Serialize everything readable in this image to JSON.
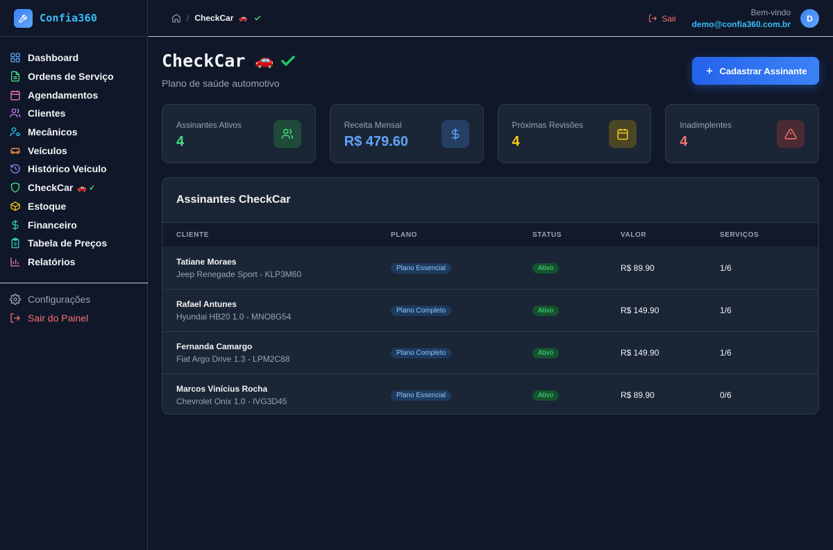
{
  "brand": {
    "name": "Confia360"
  },
  "sidebar": {
    "items": [
      {
        "label": "Dashboard",
        "icon": "grid-icon",
        "color": "#60a5fa"
      },
      {
        "label": "Ordens de Serviço",
        "icon": "file-icon",
        "color": "#4ade80"
      },
      {
        "label": "Agendamentos",
        "icon": "calendar-icon",
        "color": "#f472b6"
      },
      {
        "label": "Clientes",
        "icon": "users-icon",
        "color": "#c084fc"
      },
      {
        "label": "Mecânicos",
        "icon": "user-cog-icon",
        "color": "#22d3ee"
      },
      {
        "label": "Veículos",
        "icon": "car-icon",
        "color": "#fb923c"
      },
      {
        "label": "Histórico Veículo",
        "icon": "history-icon",
        "color": "#818cf8"
      },
      {
        "label": "CheckCar",
        "icon": "shield-icon",
        "color": "#4ade80",
        "suffix": "🚗 ✓"
      },
      {
        "label": "Estoque",
        "icon": "box-icon",
        "color": "#facc15"
      },
      {
        "label": "Financeiro",
        "icon": "dollar-icon",
        "color": "#34d399"
      },
      {
        "label": "Tabela de Preços",
        "icon": "clipboard-icon",
        "color": "#2dd4bf"
      },
      {
        "label": "Relatórios",
        "icon": "bar-chart-icon",
        "color": "#f472b6"
      }
    ],
    "settings_label": "Configurações",
    "logout_label": "Sair do Painel"
  },
  "topbar": {
    "breadcrumb_current": "CheckCar",
    "breadcrumb_sep": "/",
    "logout_label": "Sair",
    "welcome": "Bem-vindo",
    "email": "demo@confia360.com.br",
    "avatar_initial": "D"
  },
  "page": {
    "title": "CheckCar",
    "subtitle": "Plano de saúde automotivo",
    "add_button_label": "Cadastrar Assinante"
  },
  "stats": [
    {
      "label": "Assinantes Ativos",
      "value": "4",
      "value_color": "#4ade80",
      "icon": "users-icon",
      "icon_bg": "#1f4a3a",
      "icon_color": "#4ade80"
    },
    {
      "label": "Receita Mensal",
      "value": "R$ 479.60",
      "value_color": "#60a5fa",
      "icon": "dollar-icon",
      "icon_bg": "#253f63",
      "icon_color": "#60a5fa"
    },
    {
      "label": "Próximas Revisões",
      "value": "4",
      "value_color": "#facc15",
      "icon": "calendar-icon",
      "icon_bg": "#4a4626",
      "icon_color": "#facc15"
    },
    {
      "label": "Inadimplentes",
      "value": "4",
      "value_color": "#f87171",
      "icon": "alert-icon",
      "icon_bg": "#4a2b33",
      "icon_color": "#f87171"
    }
  ],
  "table": {
    "title": "Assinantes CheckCar",
    "headers": [
      "CLIENTE",
      "PLANO",
      "STATUS",
      "VALOR",
      "SERVIÇOS"
    ],
    "rows": [
      {
        "name": "Tatiane Moraes",
        "car": "Jeep Renegade Sport - KLP3M60",
        "plan": "Plano Essencial",
        "status": "Ativo",
        "value": "R$ 89.90",
        "services": "1/6"
      },
      {
        "name": "Rafael Antunes",
        "car": "Hyundai HB20 1.0 - MNO8G54",
        "plan": "Plano Completo",
        "status": "Ativo",
        "value": "R$ 149.90",
        "services": "1/6"
      },
      {
        "name": "Fernanda Camargo",
        "car": "Fiat Argo Drive 1.3 - LPM2C88",
        "plan": "Plano Completo",
        "status": "Ativo",
        "value": "R$ 149.90",
        "services": "1/6"
      },
      {
        "name": "Marcos Vinícius Rocha",
        "car": "Chevrolet Onix 1.0 - IVG3D45",
        "plan": "Plano Essencial",
        "status": "Ativo",
        "value": "R$ 89.90",
        "services": "0/6"
      }
    ]
  }
}
